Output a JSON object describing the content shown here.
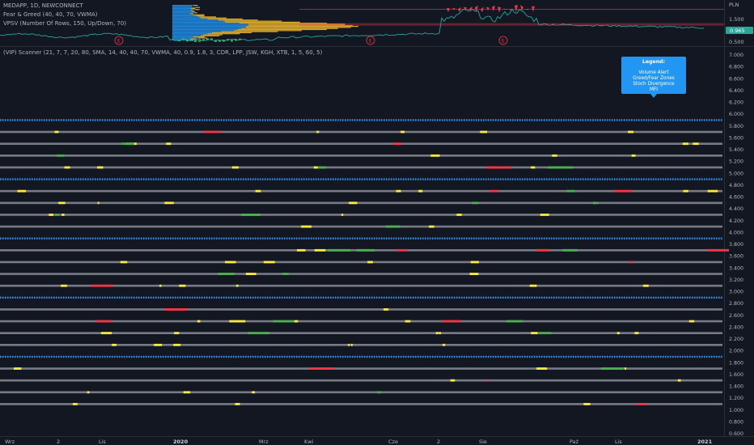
{
  "header": {
    "symbol_line": "MEDAPP, 1D, NEWCONNECT",
    "indicator_1": "Fear & Greed (40, 40, 70, VWMA)",
    "indicator_2": "VPSV (Number Of Rows, 150, Up/Down, 70)",
    "currency": "PLN"
  },
  "price_pane": {
    "ticks": [
      "1.500",
      "1.000",
      "0.500"
    ],
    "current_price": "0.965",
    "earnings_markers": [
      "E",
      "E",
      "E"
    ]
  },
  "scanner_pane": {
    "title": "(VIP) Scanner (21, 7, 7, 20, 80, SMA, 14, 40, 40, 70, VWMA, 40, 0.9, 1.8, 3, CDR, LPP, JSW, KGH, XTB, 1, 5, 60, 5)",
    "y_ticks": [
      "7.000",
      "6.800",
      "6.600",
      "6.400",
      "6.200",
      "6.000",
      "5.800",
      "5.600",
      "5.400",
      "5.200",
      "5.000",
      "4.800",
      "4.600",
      "4.400",
      "4.200",
      "4.000",
      "3.800",
      "3.600",
      "3.400",
      "3.200",
      "3.000",
      "2.800",
      "2.600",
      "2.400",
      "2.200",
      "2.000",
      "1.800",
      "1.600",
      "1.400",
      "1.200",
      "1.000",
      "0.800",
      "0.600"
    ]
  },
  "legend_box": {
    "title": "Legend:",
    "items": [
      "Volume Alert",
      "Greed/Fear Zones",
      "Stoch Divergence",
      "MFI"
    ]
  },
  "x_axis": {
    "labels": [
      "Wrz",
      "2",
      "Lis",
      "2020",
      "Mrz",
      "Kwi",
      "Cze",
      "2",
      "Sie",
      "Paź",
      "Lis",
      "2021"
    ]
  },
  "colors": {
    "background": "#131722",
    "blue_dots": "#2196f3",
    "gray_line": "#787b86",
    "yellow": "#ffeb3b",
    "red": "#f23645",
    "green": "#4caf50",
    "legend_bg": "#2196f3",
    "price_line": "#f23645"
  },
  "chart_data": {
    "type": "scatter",
    "ylim": [
      0.6,
      7.0
    ],
    "blue_rows": [
      5.9,
      4.9,
      3.9,
      2.9,
      1.9
    ],
    "gray_rows": [
      5.7,
      5.5,
      5.3,
      5.1,
      4.7,
      4.5,
      4.3,
      4.1,
      3.7,
      3.5,
      3.3,
      3.1,
      2.7,
      2.5,
      2.3,
      2.1,
      1.7,
      1.5,
      1.3,
      1.1
    ],
    "price_ylim": [
      0.35,
      1.75
    ]
  }
}
